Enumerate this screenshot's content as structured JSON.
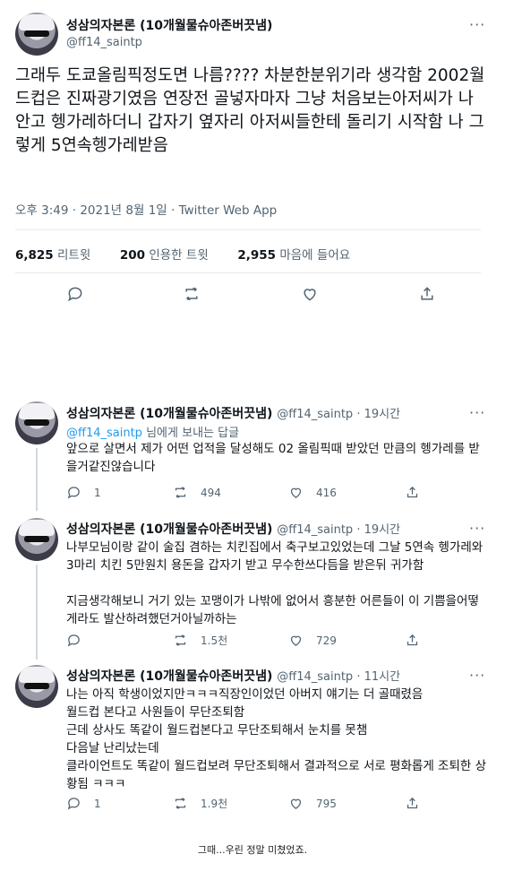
{
  "main_tweet": {
    "display_name": "성삼의자본론 (10개월물슈아존버끗냄)",
    "handle": "@ff14_saintp",
    "text": "그래두 도쿄올림픽정도면 나름???? 차분한분위기라 생각함 2002월드컵은 진짜광기였음 연장전 골넣자마자 그냥 처음보는아저씨가 나 안고 헹가레하더니 갑자기 옆자리 아저씨들한테 돌리기 시작함 나 그렇게 5연속헹가레받음",
    "timestamp": "오후 3:49 · 2021년 8월 1일 · Twitter Web App",
    "retweets_count": "6,825",
    "retweets_label": "리트윗",
    "quotes_count": "200",
    "quotes_label": "인용한 트윗",
    "likes_count": "2,955",
    "likes_label": "마음에 들어요"
  },
  "replies": [
    {
      "display_name": "성삼의자본론 (10개월물슈아존버끗냄)",
      "handle": "@ff14_saintp",
      "time": "19시간",
      "reply_to_handle": "@ff14_saintp",
      "reply_to_suffix": "님에게 보내는 답글",
      "text": "앞으로 살면서 제가 어떤 업적을 달성해도 02 올림픽때 받았던 만큼의 헹가레를 받을거같진않습니다",
      "replies": "1",
      "retweets": "494",
      "likes": "416"
    },
    {
      "display_name": "성삼의자본론 (10개월물슈아존버끗냄)",
      "handle": "@ff14_saintp",
      "time": "19시간",
      "text_1": "나부모님이랑 같이 술집 겸하는 치킨집에서 축구보고있었는데 그날 5연속 헹가레와 3마리 치킨 5만원치 용돈을 갑자기 받고 무수한쓰다듬을 받은뒤 귀가함",
      "text_2": "지금생각해보니 거기 있는 꼬맹이가 나밖에 없어서 흥분한 어른들이 이 기쁨을어떻게라도 발산하려했던거아닐까하는",
      "replies": "",
      "retweets": "1.5천",
      "likes": "729"
    },
    {
      "display_name": "성삼의자본론 (10개월물슈아존버끗냄)",
      "handle": "@ff14_saintp",
      "time": "11시간",
      "line_1": "나는 아직 학생이었지만ㅋㅋㅋ직장인이었던 아버지 얘기는 더 골때렸음",
      "line_2": "월드컵 본다고 사원들이 무단조퇴함",
      "line_3": "근데 상사도 똑같이 월드컵본다고 무단조퇴해서 눈치를 못챔",
      "line_4": "다음날 난리났는데",
      "line_5": "클라이언트도 똑같이 월드컵보려 무단조퇴해서 결과적으로 서로 평화롭게 조퇴한 상황됨 ㅋㅋㅋ",
      "replies": "1",
      "retweets": "1.9천",
      "likes": "795"
    }
  ],
  "caption": "그때...우린 정말 미쳤었죠."
}
